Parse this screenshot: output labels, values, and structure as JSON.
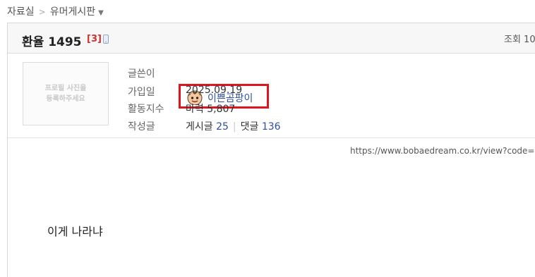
{
  "breadcrumb": {
    "items": [
      "자료실",
      "유머게시판"
    ],
    "separator": ">"
  },
  "post": {
    "title": "환율 1495",
    "comment_count": "[3]",
    "views_label": "조회 10"
  },
  "profile": {
    "photo_placeholder": "프로필 사진을\n등록하주세요",
    "labels": {
      "author": "글쓴이",
      "joined": "가입일",
      "activity": "활동지수",
      "posts": "작성글"
    },
    "author_name": "이쁜곰팡이",
    "joined_date": "2025.09.19",
    "activity_value": "마력 5,807",
    "posts_label": "게시글",
    "posts_count": "25",
    "comments_label": "댓글",
    "comments_count": "136"
  },
  "content": {
    "source_url": "https://www.bobaedream.co.kr/view?code=",
    "text": "이게 나라냐"
  },
  "colors": {
    "highlight_box": "#e0141e",
    "link": "#2c4f9e",
    "comment_count": "#d32f2f"
  }
}
